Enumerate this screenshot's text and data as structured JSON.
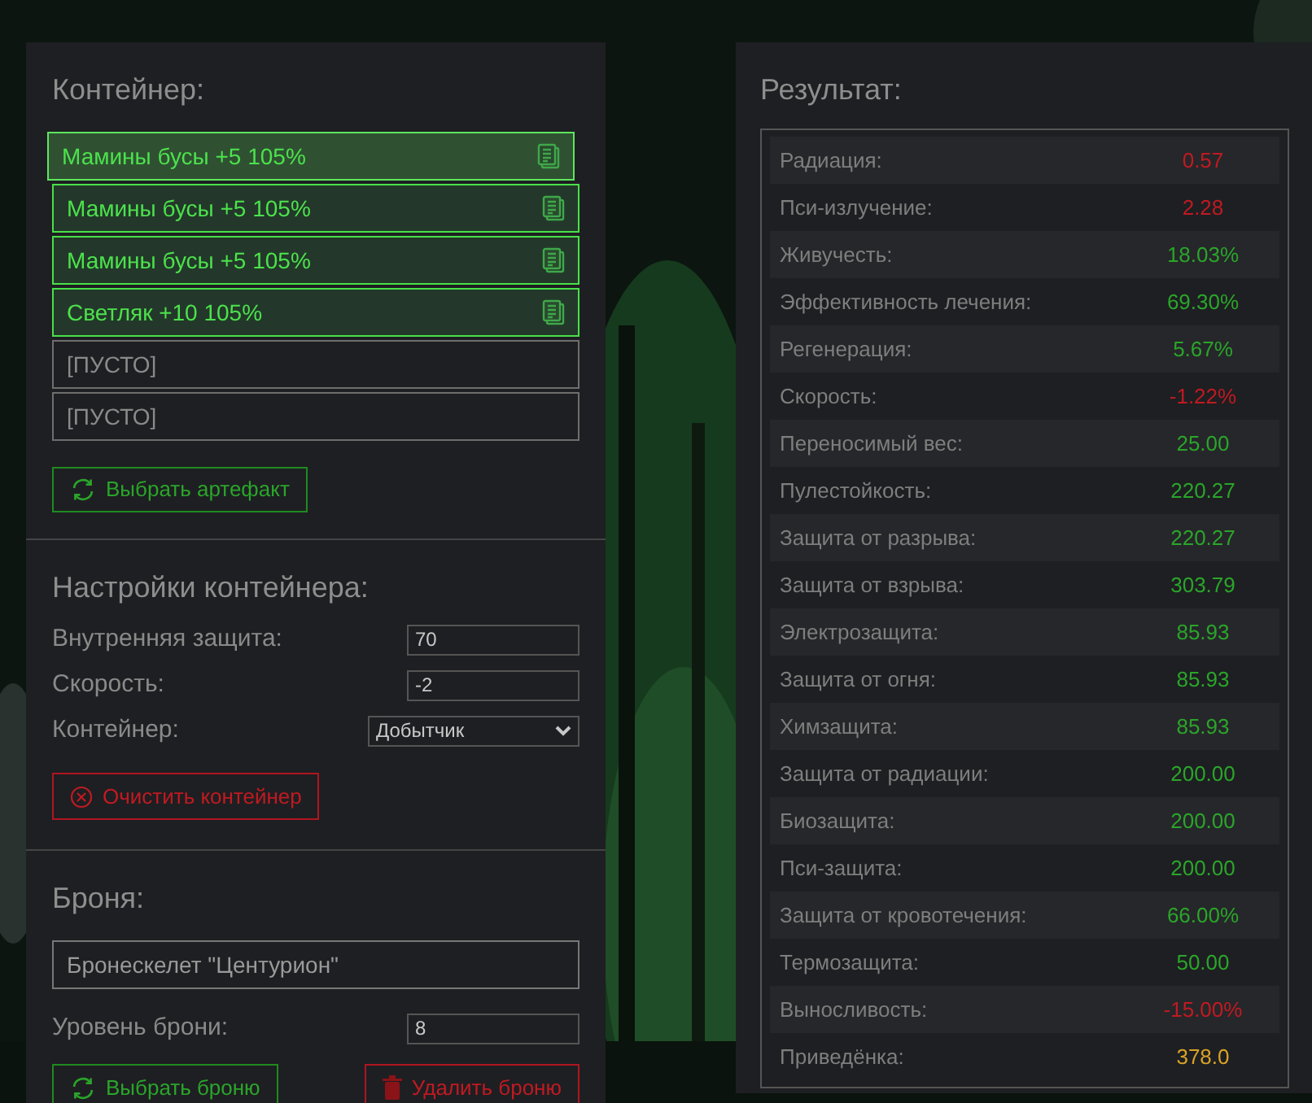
{
  "container": {
    "title": "Контейнер:",
    "slots": [
      {
        "kind": "artifact",
        "text": "Мамины бусы +5 105%",
        "highlighted": true
      },
      {
        "kind": "artifact",
        "text": "Мамины бусы +5 105%",
        "highlighted": false
      },
      {
        "kind": "artifact",
        "text": "Мамины бусы +5 105%",
        "highlighted": false
      },
      {
        "kind": "artifact",
        "text": "Светляк +10 105%",
        "highlighted": false
      },
      {
        "kind": "empty",
        "text": "[ПУСТО]",
        "highlighted": false
      },
      {
        "kind": "empty",
        "text": "[ПУСТО]",
        "highlighted": false
      }
    ],
    "choose_button": "Выбрать артефакт"
  },
  "settings": {
    "title": "Настройки контейнера:",
    "fields": [
      {
        "kind": "input",
        "label": "Внутренняя защита:",
        "value": "70"
      },
      {
        "kind": "input",
        "label": "Скорость:",
        "value": "-2"
      },
      {
        "kind": "select",
        "label": "Контейнер:",
        "value": "Добытчик"
      }
    ],
    "clear_button": "Очистить контейнер"
  },
  "armor": {
    "title": "Броня:",
    "name": "Бронескелет \"Центурион\"",
    "level_label": "Уровень брони:",
    "level_value": "8",
    "choose_button": "Выбрать броню",
    "delete_button": "Удалить броню"
  },
  "result": {
    "title": "Результат:",
    "rows": [
      {
        "label": "Радиация:",
        "value": "0.57",
        "kind": "negative"
      },
      {
        "label": "Пси-излучение:",
        "value": "2.28",
        "kind": "negative"
      },
      {
        "label": "Живучесть:",
        "value": "18.03%",
        "kind": "positive"
      },
      {
        "label": "Эффективность лечения:",
        "value": "69.30%",
        "kind": "positive"
      },
      {
        "label": "Регенерация:",
        "value": "5.67%",
        "kind": "positive"
      },
      {
        "label": "Скорость:",
        "value": "-1.22%",
        "kind": "negative"
      },
      {
        "label": "Переносимый вес:",
        "value": "25.00",
        "kind": "positive"
      },
      {
        "label": "Пулестойкость:",
        "value": "220.27",
        "kind": "positive"
      },
      {
        "label": "Защита от разрыва:",
        "value": "220.27",
        "kind": "positive"
      },
      {
        "label": "Защита от взрыва:",
        "value": "303.79",
        "kind": "positive"
      },
      {
        "label": "Электрозащита:",
        "value": "85.93",
        "kind": "positive"
      },
      {
        "label": "Защита от огня:",
        "value": "85.93",
        "kind": "positive"
      },
      {
        "label": "Химзащита:",
        "value": "85.93",
        "kind": "positive"
      },
      {
        "label": "Защита от радиации:",
        "value": "200.00",
        "kind": "positive"
      },
      {
        "label": "Биозащита:",
        "value": "200.00",
        "kind": "positive"
      },
      {
        "label": "Пси-защита:",
        "value": "200.00",
        "kind": "positive"
      },
      {
        "label": "Защита от кровотечения:",
        "value": "66.00%",
        "kind": "positive"
      },
      {
        "label": "Термозащита:",
        "value": "50.00",
        "kind": "positive"
      },
      {
        "label": "Выносливость:",
        "value": "-15.00%",
        "kind": "negative"
      },
      {
        "label": "Приведёнка:",
        "value": "378.0",
        "kind": "total"
      }
    ]
  }
}
